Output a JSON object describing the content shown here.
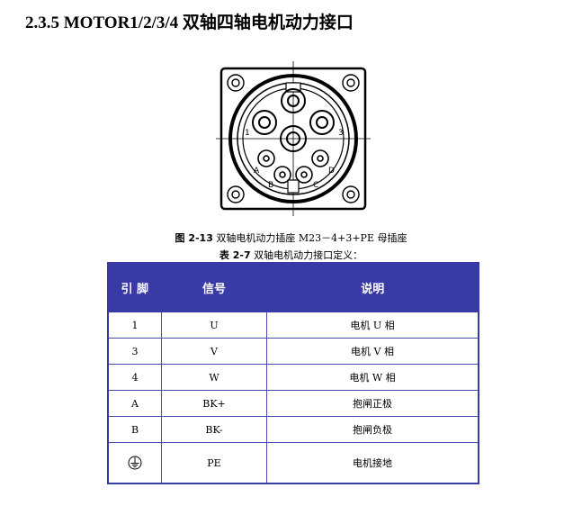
{
  "section": {
    "title": "2.3.5 MOTOR1/2/3/4  双轴四轴电机动力接口"
  },
  "figure": {
    "pin_labels": [
      "1",
      "3",
      "A",
      "D",
      "B",
      "C"
    ],
    "caption_prefix": "图 2-13",
    "caption_text": " 双轴电机动力插座 M23－4+3+PE  母插座"
  },
  "table_caption": {
    "prefix": "表 2-7",
    "text": " 双轴电机动力接口定义："
  },
  "table": {
    "headers": [
      "引 脚",
      "信号",
      "说明"
    ],
    "rows": [
      {
        "pin": "1",
        "signal": "U",
        "desc": "电机 U 相"
      },
      {
        "pin": "3",
        "signal": "V",
        "desc": "电机 V 相"
      },
      {
        "pin": "4",
        "signal": "W",
        "desc": "电机 W 相"
      },
      {
        "pin": "A",
        "signal": "BK+",
        "desc": "抱闸正极"
      },
      {
        "pin": "B",
        "signal": "BK-",
        "desc": "抱闸负极"
      },
      {
        "pin": "ground-symbol",
        "signal": "PE",
        "desc": "电机接地"
      }
    ]
  }
}
